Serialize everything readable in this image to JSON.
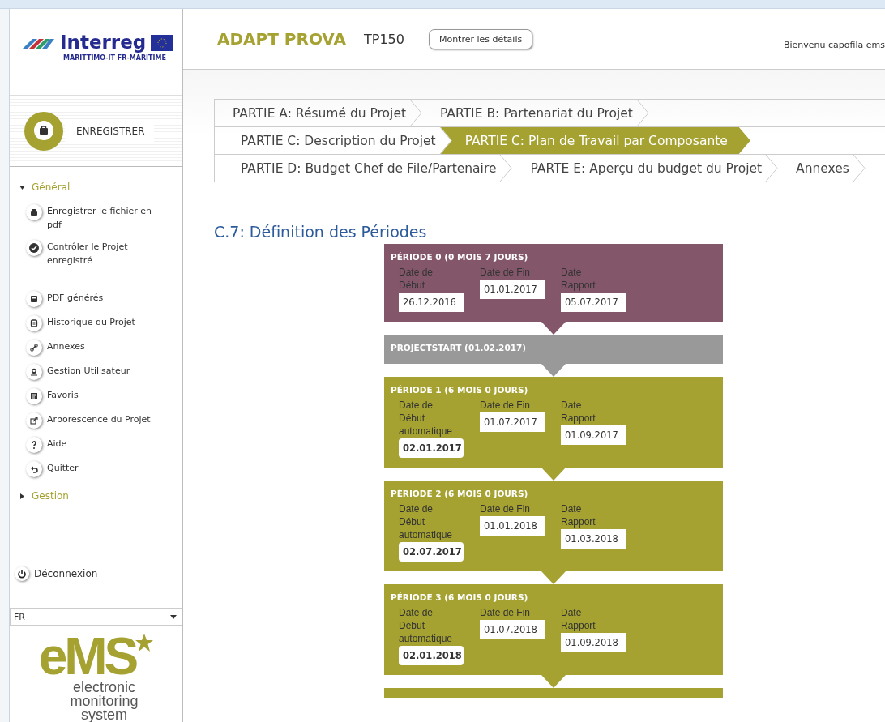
{
  "sidebar": {
    "logo": {
      "name": "Interreg",
      "subtitle": "MARITTIMO-IT FR-MARITIME"
    },
    "save_button": "ENREGISTRER",
    "sections": [
      {
        "label": "Général",
        "expanded": true,
        "groups": [
          [
            {
              "label": "Enregistrer le fichier en pdf"
            },
            {
              "label": "Contrôler le Projet enregistré"
            }
          ],
          [
            {
              "label": "PDF générés"
            },
            {
              "label": "Historique du Projet"
            },
            {
              "label": "Annexes"
            },
            {
              "label": "Gestion Utilisateur"
            },
            {
              "label": "Favoris"
            },
            {
              "label": "Arborescence du Projet"
            },
            {
              "label": "Aide"
            },
            {
              "label": "Quitter"
            }
          ]
        ]
      },
      {
        "label": "Gestion",
        "expanded": false
      }
    ],
    "logout": "Déconnexion",
    "language": "FR",
    "ems_logo": {
      "mark": "eMS",
      "lines": [
        "electronic",
        "monitoring",
        "system"
      ]
    }
  },
  "header": {
    "project": "ADAPT PROVA",
    "code": "TP150",
    "details_button": "Montrer les détails",
    "welcome": "Bienvenu capofila ems"
  },
  "tab_rows": [
    [
      {
        "label": "PARTIE A: Résumé du Projet",
        "selected": false
      },
      {
        "label": "PARTIE B: Partenariat du Projet",
        "selected": false
      }
    ],
    [
      {
        "label": "PARTIE C: Description du Projet",
        "selected": false
      },
      {
        "label": "PARTIE C: Plan de Travail par Composante",
        "selected": true
      }
    ],
    [
      {
        "label": "PARTIE D: Budget Chef de File/Partenaire",
        "selected": false
      },
      {
        "label": "PARTE E: Aperçu du budget du Projet",
        "selected": false
      },
      {
        "label": "Annexes",
        "selected": false
      }
    ]
  ],
  "heading": "C.7: Définition des Périodes",
  "periods": [
    {
      "kind": "period",
      "color": "#84566a",
      "title": "PÉRIODE 0 (0 MOIS 7 JOURS)",
      "fields": [
        {
          "label": "Date de Début",
          "value": "26.12.2016",
          "automatic": false
        },
        {
          "label": "Date de Fin",
          "value": "01.01.2017",
          "automatic": false
        },
        {
          "label": "Date Rapport",
          "value": "05.07.2017",
          "automatic": false
        }
      ]
    },
    {
      "kind": "start",
      "color": "#999999",
      "title": "PROJECTSTART (01.02.2017)"
    },
    {
      "kind": "period",
      "color": "#a5a231",
      "title": "PÉRIODE 1 (6 MOIS 0 JOURS)",
      "fields": [
        {
          "label": "Date de Début automatique",
          "value": "02.01.2017",
          "automatic": true
        },
        {
          "label": "Date de Fin",
          "value": "01.07.2017",
          "automatic": false
        },
        {
          "label": "Date Rapport",
          "value": "01.09.2017",
          "automatic": false
        }
      ]
    },
    {
      "kind": "period",
      "color": "#a5a231",
      "title": "PÉRIODE 2 (6 MOIS 0 JOURS)",
      "fields": [
        {
          "label": "Date de Début automatique",
          "value": "02.07.2017",
          "automatic": true
        },
        {
          "label": "Date de Fin",
          "value": "01.01.2018",
          "automatic": false
        },
        {
          "label": "Date Rapport",
          "value": "01.03.2018",
          "automatic": false
        }
      ]
    },
    {
      "kind": "period",
      "color": "#a5a231",
      "title": "PÉRIODE 3 (6 MOIS 0 JOURS)",
      "fields": [
        {
          "label": "Date de Début automatique",
          "value": "02.01.2018",
          "automatic": true
        },
        {
          "label": "Date de Fin",
          "value": "01.07.2018",
          "automatic": false
        },
        {
          "label": "Date Rapport",
          "value": "01.09.2018",
          "automatic": false
        }
      ]
    },
    {
      "kind": "cut",
      "color": "#a5a231"
    }
  ]
}
